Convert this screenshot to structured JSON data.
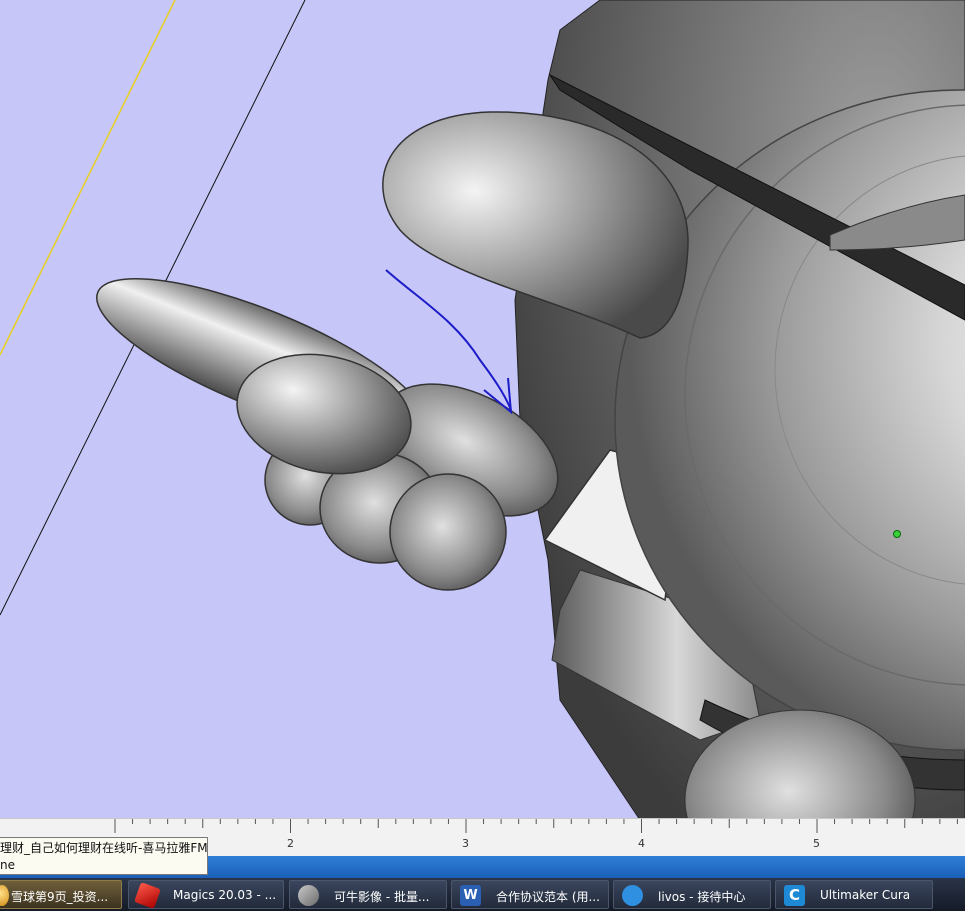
{
  "ruler": {
    "labels": [
      "2",
      "3",
      "4",
      "5"
    ]
  },
  "tooltip": {
    "line1": "理财_自己如何理财在线听-喜马拉雅FM",
    "line2": "ne"
  },
  "taskbar": {
    "items": [
      {
        "label": "雪球第9页_投资...",
        "icon": "browser-icon",
        "active": true
      },
      {
        "label": "Magics 20.03 - ...",
        "icon": "magics-icon",
        "active": false
      },
      {
        "label": "可牛影像 - 批量...",
        "icon": "image-editor-icon",
        "active": false
      },
      {
        "label": "合作协议范本 (用...",
        "icon": "word-icon",
        "active": false
      },
      {
        "label": "livos - 接待中心",
        "icon": "chat-icon",
        "active": false
      },
      {
        "label": "Ultimaker Cura",
        "icon": "cura-icon",
        "active": false
      }
    ]
  },
  "colors": {
    "viewport_bg": "#c6c6f8",
    "annotation_arrow": "#1c1cc8",
    "yellow_axis": "#e8d020",
    "statusbar": "#2a6fce"
  }
}
